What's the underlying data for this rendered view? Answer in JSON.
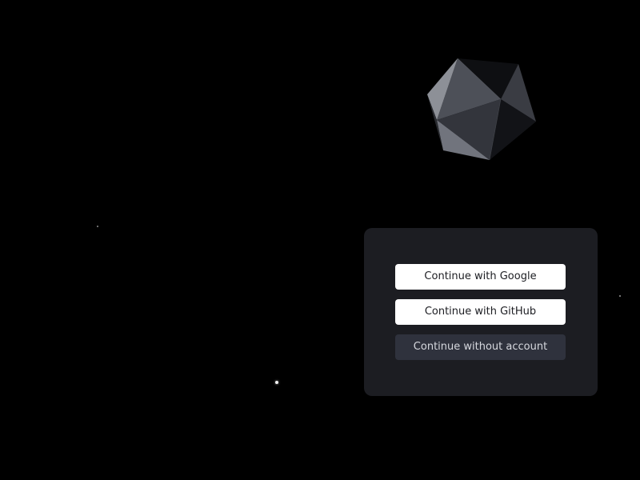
{
  "background": {
    "color": "#000000"
  },
  "decoration": {
    "gem_icon": "icosahedron-icon",
    "star_icon": "star-icon"
  },
  "login": {
    "google_label": "Continue with Google",
    "github_label": "Continue with GitHub",
    "guest_label": "Continue without account",
    "card_color": "#1c1d22",
    "primary_button_color": "#ffffff",
    "secondary_button_color": "#2f323d"
  }
}
